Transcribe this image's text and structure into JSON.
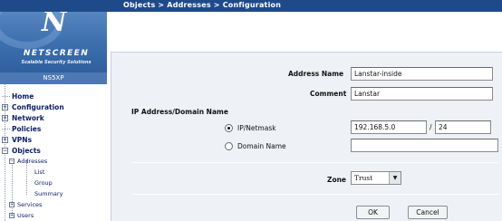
{
  "header": {
    "breadcrumb": "Objects > Addresses > Configuration"
  },
  "logo": {
    "brand": "NETSCREEN",
    "tagline": "Scalable Security Solutions",
    "model": "NS5XP"
  },
  "nav": {
    "items": [
      {
        "label": "Home",
        "expander": ""
      },
      {
        "label": "Configuration",
        "expander": "+"
      },
      {
        "label": "Network",
        "expander": "+"
      },
      {
        "label": "Policies",
        "expander": ""
      },
      {
        "label": "VPNs",
        "expander": "+"
      },
      {
        "label": "Objects",
        "expander": "−"
      }
    ],
    "addresses": {
      "label": "Addresses",
      "expander": "−"
    },
    "address_children": [
      "List",
      "Group",
      "Summary"
    ],
    "services": {
      "label": "Services",
      "expander": "+"
    },
    "users": {
      "label": "Users",
      "expander": "+"
    }
  },
  "form": {
    "address_name_label": "Address Name",
    "address_name_value": "Lanstar-inside",
    "comment_label": "Comment",
    "comment_value": "Lanstar",
    "section_label": "IP Address/Domain Name",
    "ip_option_label": "IP/Netmask",
    "ip_value": "192.168.5.0",
    "slash": "/",
    "netmask_value": "24",
    "domain_option_label": "Domain Name",
    "domain_value": "",
    "selected_option": "ip",
    "zone_label": "Zone",
    "zone_value": "Trust",
    "zone_options": [
      "Trust"
    ],
    "ok_label": "OK",
    "cancel_label": "Cancel"
  },
  "colors": {
    "topbar": "#1f4a8a",
    "sidebar_logo": "#3d6fae",
    "panel": "#eef1f6",
    "nav_text": "#0a1e64"
  }
}
